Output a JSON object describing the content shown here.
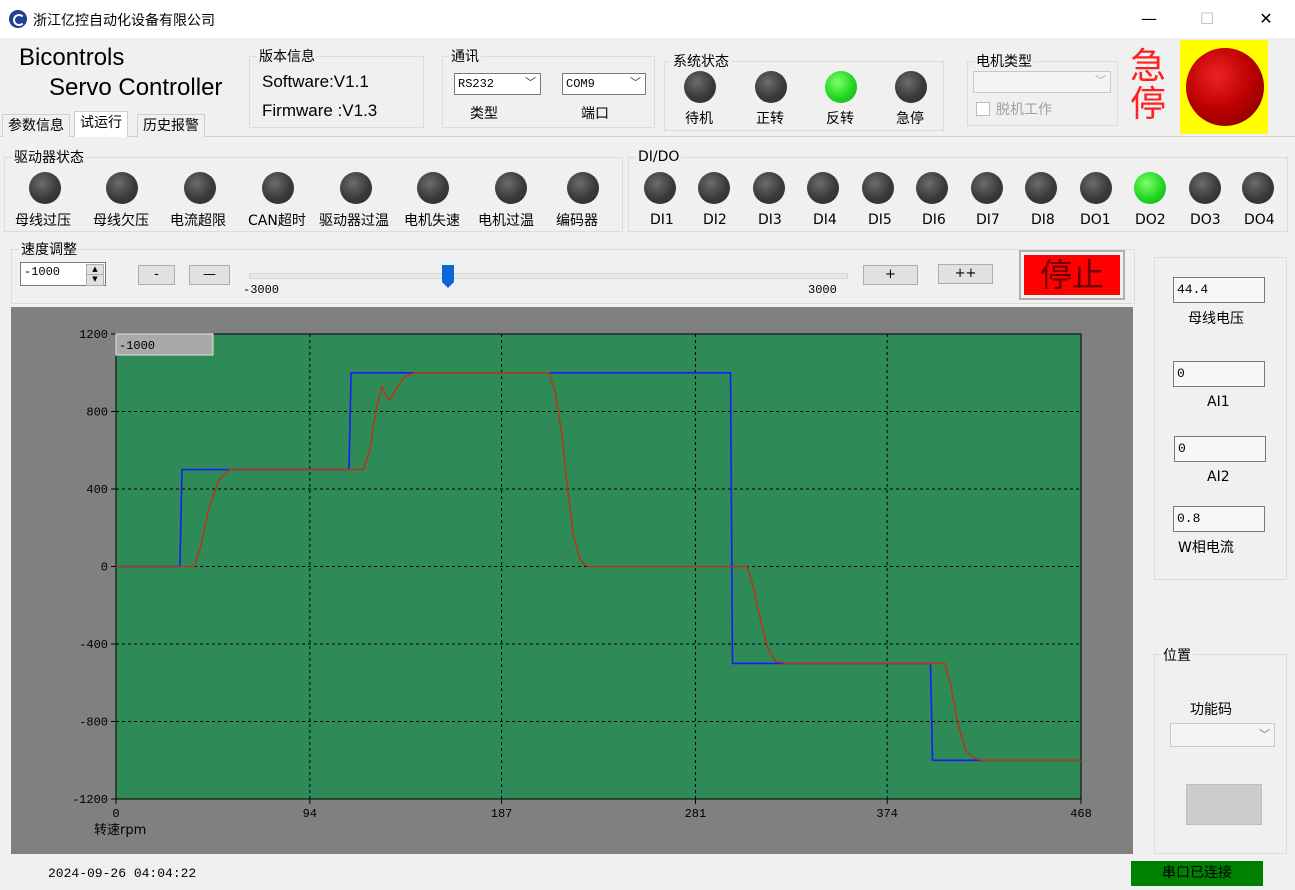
{
  "window": {
    "title": "浙江亿控自动化设备有限公司",
    "min": "—",
    "max": "☐",
    "close": "✕"
  },
  "brand": {
    "line1": "Bicontrols",
    "line2": "Servo Controller"
  },
  "version": {
    "title": "版本信息",
    "software": "Software:V1.1",
    "firmware": "Firmware :V1.3"
  },
  "comm": {
    "title": "通讯",
    "type_value": "RS232",
    "type_label": "类型",
    "port_value": "COM9",
    "port_label": "端口"
  },
  "system_status": {
    "title": "系统状态",
    "items": [
      {
        "label": "待机",
        "on": false
      },
      {
        "label": "正转",
        "on": false
      },
      {
        "label": "反转",
        "on": true
      },
      {
        "label": "急停",
        "on": false
      }
    ]
  },
  "motor": {
    "title": "电机类型",
    "value": "",
    "offline_label": "脱机工作"
  },
  "estop": {
    "label": "急停",
    "color": "#cc0000",
    "bg": "#ffff00"
  },
  "tabs": [
    {
      "label": "参数信息"
    },
    {
      "label": "试运行"
    },
    {
      "label": "历史报警"
    }
  ],
  "driver_status": {
    "title": "驱动器状态",
    "items": [
      {
        "label": "母线过压",
        "on": false
      },
      {
        "label": "母线欠压",
        "on": false
      },
      {
        "label": "电流超限",
        "on": false
      },
      {
        "label": "CAN超时",
        "on": false
      },
      {
        "label": "驱动器过温",
        "on": false
      },
      {
        "label": "电机失速",
        "on": false
      },
      {
        "label": "电机过温",
        "on": false
      },
      {
        "label": "编码器",
        "on": false
      }
    ]
  },
  "dio": {
    "title": "DI/DO",
    "items": [
      {
        "label": "DI1",
        "on": false
      },
      {
        "label": "DI2",
        "on": false
      },
      {
        "label": "DI3",
        "on": false
      },
      {
        "label": "DI4",
        "on": false
      },
      {
        "label": "DI5",
        "on": false
      },
      {
        "label": "DI6",
        "on": false
      },
      {
        "label": "DI7",
        "on": false
      },
      {
        "label": "DI8",
        "on": false
      },
      {
        "label": "DO1",
        "on": false
      },
      {
        "label": "DO2",
        "on": true
      },
      {
        "label": "DO3",
        "on": false
      },
      {
        "label": "DO4",
        "on": false
      }
    ]
  },
  "speed": {
    "title": "速度调整",
    "value": "-1000",
    "minus_small": "-",
    "minus_big": "—",
    "plus_small": "+",
    "plus_big": "++",
    "slider_min": "-3000",
    "slider_max": "3000",
    "slider_value": -1000,
    "stop_label": "停止",
    "stop_bg": "#ff0000"
  },
  "readouts": {
    "bus_voltage_value": "44.4",
    "bus_voltage_label": "母线电压",
    "ai1_value": "0",
    "ai1_label": "AI1",
    "ai2_value": "0",
    "ai2_label": "AI2",
    "w_current_value": "0.8",
    "w_current_label": "W相电流"
  },
  "position": {
    "title": "位置",
    "func_label": "功能码",
    "func_value": ""
  },
  "status_bar": {
    "datetime": "2024-09-26 04:04:22",
    "connection": "串口已连接",
    "connection_bg": "#008000"
  },
  "chart_data": {
    "type": "line",
    "plot_bg": "#2e8b57",
    "cursor_label": "-1000",
    "xlabel": "转速rpm",
    "xlim": [
      0,
      468
    ],
    "ylim": [
      -1200,
      1200
    ],
    "xticks": [
      "0",
      "94",
      "187",
      "281",
      "374",
      "468"
    ],
    "yticks": [
      "1200",
      "800",
      "400",
      "0",
      "-400",
      "-800",
      "-1200"
    ],
    "grid": true,
    "series": [
      {
        "color": "#1a1aff",
        "x": [
          0,
          31,
          32,
          113,
          114,
          298,
          299,
          395,
          396,
          468
        ],
        "y": [
          0,
          0,
          500,
          500,
          1000,
          1000,
          -500,
          -500,
          -1000,
          -1000
        ]
      },
      {
        "color": "#b03a1a",
        "x": [
          0,
          38,
          41,
          45,
          50,
          55,
          120,
          123,
          126,
          129,
          131,
          133,
          136,
          140,
          145,
          150,
          154,
          210,
          213,
          216,
          219,
          222,
          225,
          227,
          229,
          233,
          240,
          306,
          309,
          312,
          316,
          320,
          325,
          330,
          402,
          405,
          408,
          412,
          416,
          420,
          426,
          468
        ],
        "y": [
          0,
          0,
          100,
          300,
          450,
          500,
          500,
          600,
          800,
          930,
          880,
          860,
          920,
          980,
          1000,
          1000,
          1000,
          1000,
          900,
          700,
          400,
          150,
          40,
          10,
          0,
          0,
          0,
          0,
          -100,
          -250,
          -420,
          -490,
          -500,
          -500,
          -500,
          -620,
          -800,
          -950,
          -990,
          -1000,
          -1000,
          -1000
        ]
      }
    ]
  }
}
